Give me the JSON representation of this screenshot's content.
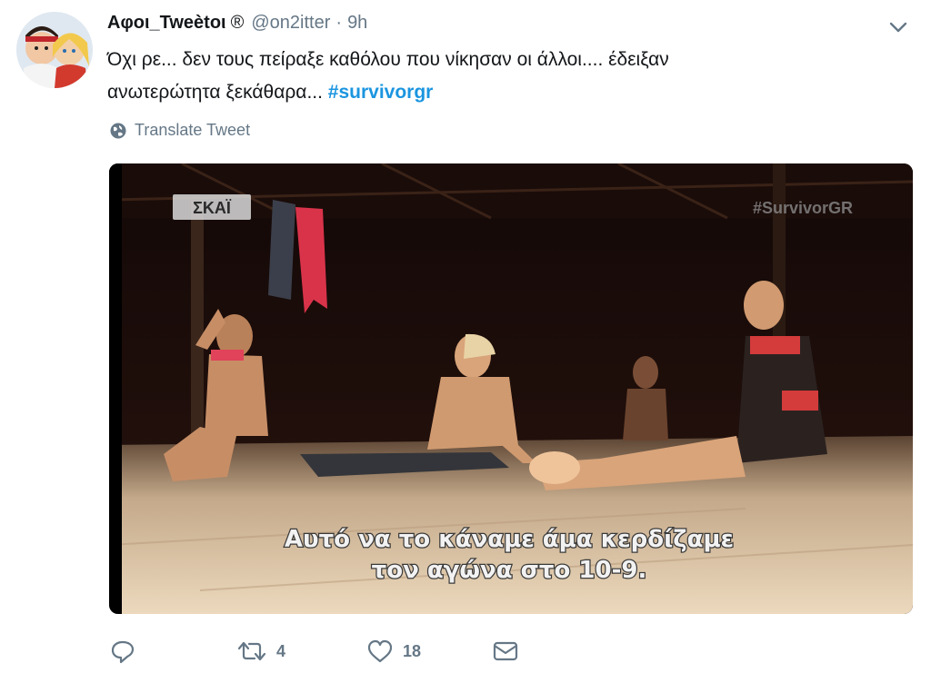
{
  "tweet": {
    "display_name": "Αφοι_Tweètοι",
    "registered_mark": "®",
    "handle": "@on2itter",
    "separator": "·",
    "time": "9h",
    "text_line1": "Όχι ρε... δεν τους πείραξε καθόλου που νίκησαν οι άλλοι.... έδειξαν",
    "text_line2": "ανωτερώτητα ξεκάθαρα... ",
    "hashtag": "#survivorgr",
    "translate_label": "Translate Tweet"
  },
  "media": {
    "channel_logo": "ΣΚΑΪ",
    "watermark": "#SurvivorGR",
    "subtitle_line1": "Αυτό να το κάναμε άμα κερδίζαμε",
    "subtitle_line2": "τον αγώνα στο 10-9."
  },
  "actions": {
    "reply_icon": "reply-icon",
    "retweet_icon": "retweet-icon",
    "retweet_count": "4",
    "like_icon": "heart-icon",
    "like_count": "18",
    "message_icon": "envelope-icon"
  },
  "colors": {
    "text": "#14171a",
    "secondary": "#657786",
    "link": "#1b95e0"
  }
}
